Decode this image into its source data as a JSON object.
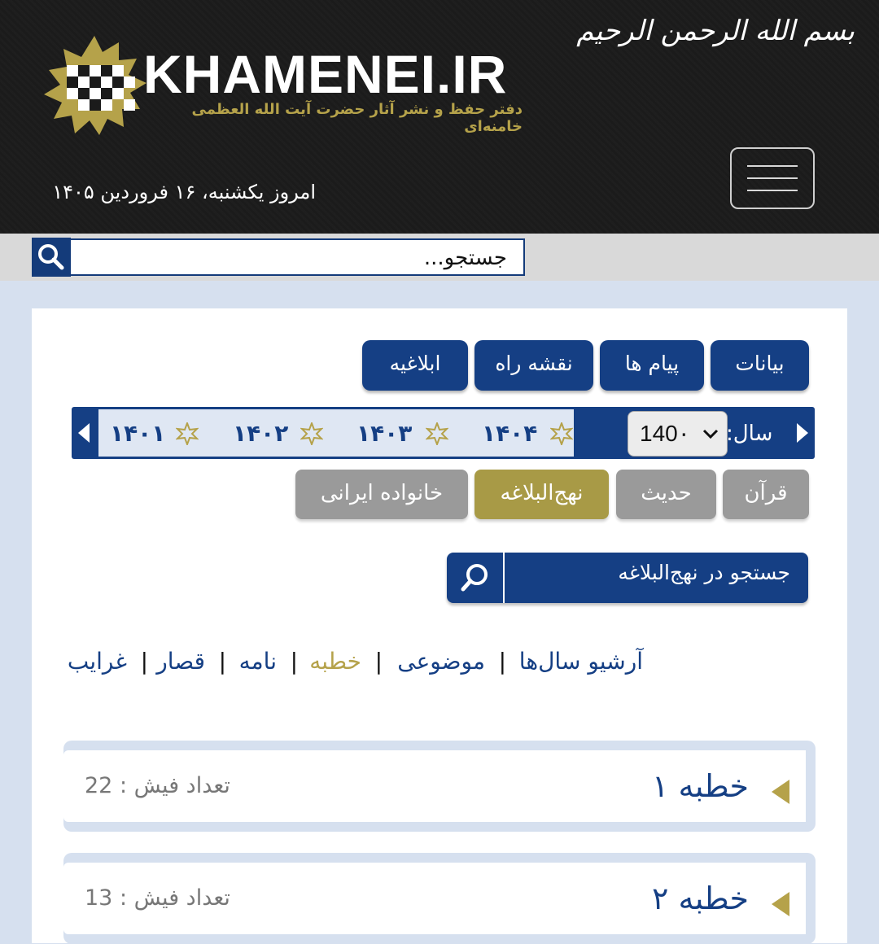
{
  "header": {
    "logo_text": "KHAMENEI.IR",
    "logo_subtitle": "دفتر حفظ و نشر آثار حضرت آیت الله العظمی خامنه‌ای",
    "bismillah": "بسم الله الرحمن الرحیم",
    "date": "امروز یکشنبه، ۱۶ فروردین ۱۴۰۵",
    "menu_icon": "hamburger-menu-icon"
  },
  "search": {
    "placeholder": "جستجو...",
    "icon": "search-icon"
  },
  "tabs": [
    {
      "label": "بیانات"
    },
    {
      "label": "پیام ها"
    },
    {
      "label": "نقشه راه"
    },
    {
      "label": "ابلاغیه"
    }
  ],
  "year_bar": {
    "label": "سال:",
    "selected": "140۰",
    "years": [
      "۱۴۰۴",
      "۱۴۰۳",
      "۱۴۰۲",
      "۱۴۰۱"
    ]
  },
  "categories": [
    {
      "label": "قرآن",
      "active": false
    },
    {
      "label": "حدیث",
      "active": false
    },
    {
      "label": "نهج‌البلاغه",
      "active": true
    },
    {
      "label": "خانواده ایرانی",
      "active": false
    }
  ],
  "nahj_search": {
    "label": "جستجو در نهج‌البلاغه"
  },
  "subnav": {
    "items": [
      "آرشیو سال‌ها",
      "موضوعی",
      "خطبه",
      "نامه",
      "قصار",
      "غرایب"
    ],
    "active": "خطبه"
  },
  "list": [
    {
      "title": "خطبه ۱",
      "count_label": "تعداد فیش : 22"
    },
    {
      "title": "خطبه ۲",
      "count_label": "تعداد فیش : 13"
    }
  ],
  "colors": {
    "navy": "#153f84",
    "gold": "#b5a24a",
    "gray": "#9a9a9a",
    "header_bg": "#1b1b1b",
    "page_bg": "#d6e0ef"
  }
}
